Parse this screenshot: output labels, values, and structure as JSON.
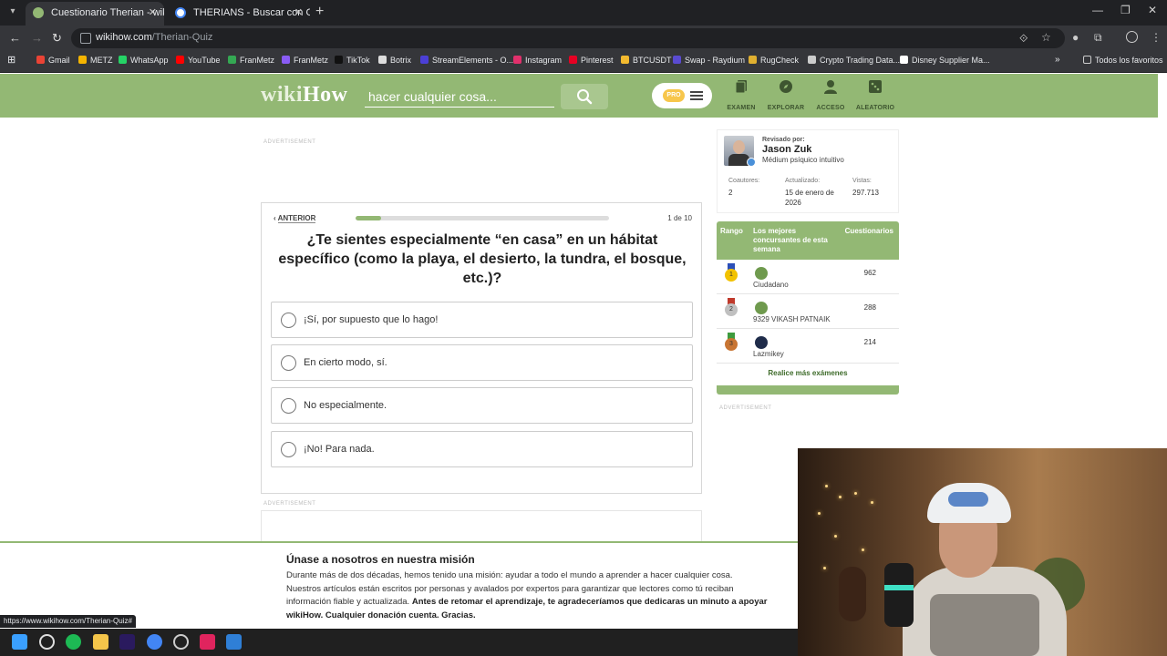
{
  "browser": {
    "tabs": [
      {
        "title": "Cuestionario Therian - wikiHow",
        "active": true,
        "favicon_color": "#93b874"
      },
      {
        "title": "THERIANS - Buscar con Google",
        "active": false,
        "favicon_color": "#4285f4"
      }
    ],
    "url_domain": "wikihow.com",
    "url_path": "/Therian-Quiz",
    "bookmarks": [
      {
        "label": "Gmail",
        "color": "#ea4335"
      },
      {
        "label": "METZ",
        "color": "#f4b400"
      },
      {
        "label": "WhatsApp",
        "color": "#25d366"
      },
      {
        "label": "YouTube",
        "color": "#ff0000"
      },
      {
        "label": "FranMetz",
        "color": "#34a853"
      },
      {
        "label": "FranMetz",
        "color": "#8a5cf6"
      },
      {
        "label": "TikTok",
        "color": "#111111"
      },
      {
        "label": "Botrix",
        "color": "#dddddd"
      },
      {
        "label": "StreamElements - O...",
        "color": "#4b3fd6"
      },
      {
        "label": "Instagram",
        "color": "#e1306c"
      },
      {
        "label": "Pinterest",
        "color": "#e60023"
      },
      {
        "label": "BTCUSDT",
        "color": "#f3ba2f"
      },
      {
        "label": "Swap - Raydium",
        "color": "#5a4bd1"
      },
      {
        "label": "RugCheck",
        "color": "#e0b030"
      },
      {
        "label": "Crypto Trading Data...",
        "color": "#cccccc"
      },
      {
        "label": "Disney Supplier Ma...",
        "color": "#ffffff"
      }
    ],
    "all_bookmarks": "Todos los favoritos",
    "status_url": "https://www.wikihow.com/Therian-Quiz#"
  },
  "header": {
    "logo_wiki": "wiki",
    "logo_how": "How",
    "search_placeholder": "hacer cualquier cosa...",
    "pro_label": "PRO",
    "nav": [
      {
        "label": "EXAMEN",
        "icon": "quiz-icon"
      },
      {
        "label": "EXPLORAR",
        "icon": "compass-icon"
      },
      {
        "label": "ACCESO",
        "icon": "user-icon"
      },
      {
        "label": "ALEATORIO",
        "icon": "dice-icon"
      }
    ]
  },
  "ads": {
    "label": "ADVERTISEMENT"
  },
  "quiz": {
    "prev_label": "ANTERIOR",
    "counter": "1 de 10",
    "progress_fraction": 0.1,
    "question": "¿Te sientes especialmente “en casa” en un hábitat específico (como la playa, el desierto, la tundra, el bosque, etc.)?",
    "options": [
      "¡Sí, por supuesto que lo hago!",
      "En cierto modo, sí.",
      "No especialmente.",
      "¡No! Para nada."
    ]
  },
  "reviewer": {
    "label": "Revisado por:",
    "name": "Jason Zuk",
    "role": "Médium psíquico intuitivo",
    "stats": [
      {
        "label": "Coautores:",
        "value": "2"
      },
      {
        "label": "Actualizado:",
        "value": "15 de enero de 2026"
      },
      {
        "label": "Vistas:",
        "value": "297.713"
      }
    ]
  },
  "leaderboard": {
    "col_rank": "Rango",
    "col_name": "Los mejores concursantes de esta semana",
    "col_score": "Cuestionarios",
    "rows": [
      {
        "rank": "1",
        "name": "Ciudadano",
        "score": "962",
        "medal_color": "#f2c200",
        "ribbon_color": "#2b4fb8"
      },
      {
        "rank": "2",
        "name": "9329 VIKASH PATNAIK",
        "score": "288",
        "medal_color": "#c0c0c0",
        "ribbon_color": "#c0392b"
      },
      {
        "rank": "3",
        "name": "Lazmikey",
        "score": "214",
        "medal_color": "#c87533",
        "ribbon_color": "#3e9b3e"
      }
    ],
    "more_link": "Realice más exámenes"
  },
  "mission": {
    "title": "Únase a nosotros en nuestra misión",
    "body": "Durante más de dos décadas, hemos tenido una misión: ayudar a todo el mundo a aprender a hacer cualquier cosa. Nuestros artículos están escritos por personas y avalados por expertos para garantizar que lectores como tú reciban información fiable y actualizada. ",
    "body_bold": "Antes de retomar el aprendizaje, te agradeceríamos que dedicaras un minuto a apoyar wikiHow. Cualquier donación cuenta. Gracias."
  },
  "colors": {
    "wikihow_green": "#93b874",
    "chrome_dark": "#202124",
    "chrome_mid": "#35363a"
  }
}
